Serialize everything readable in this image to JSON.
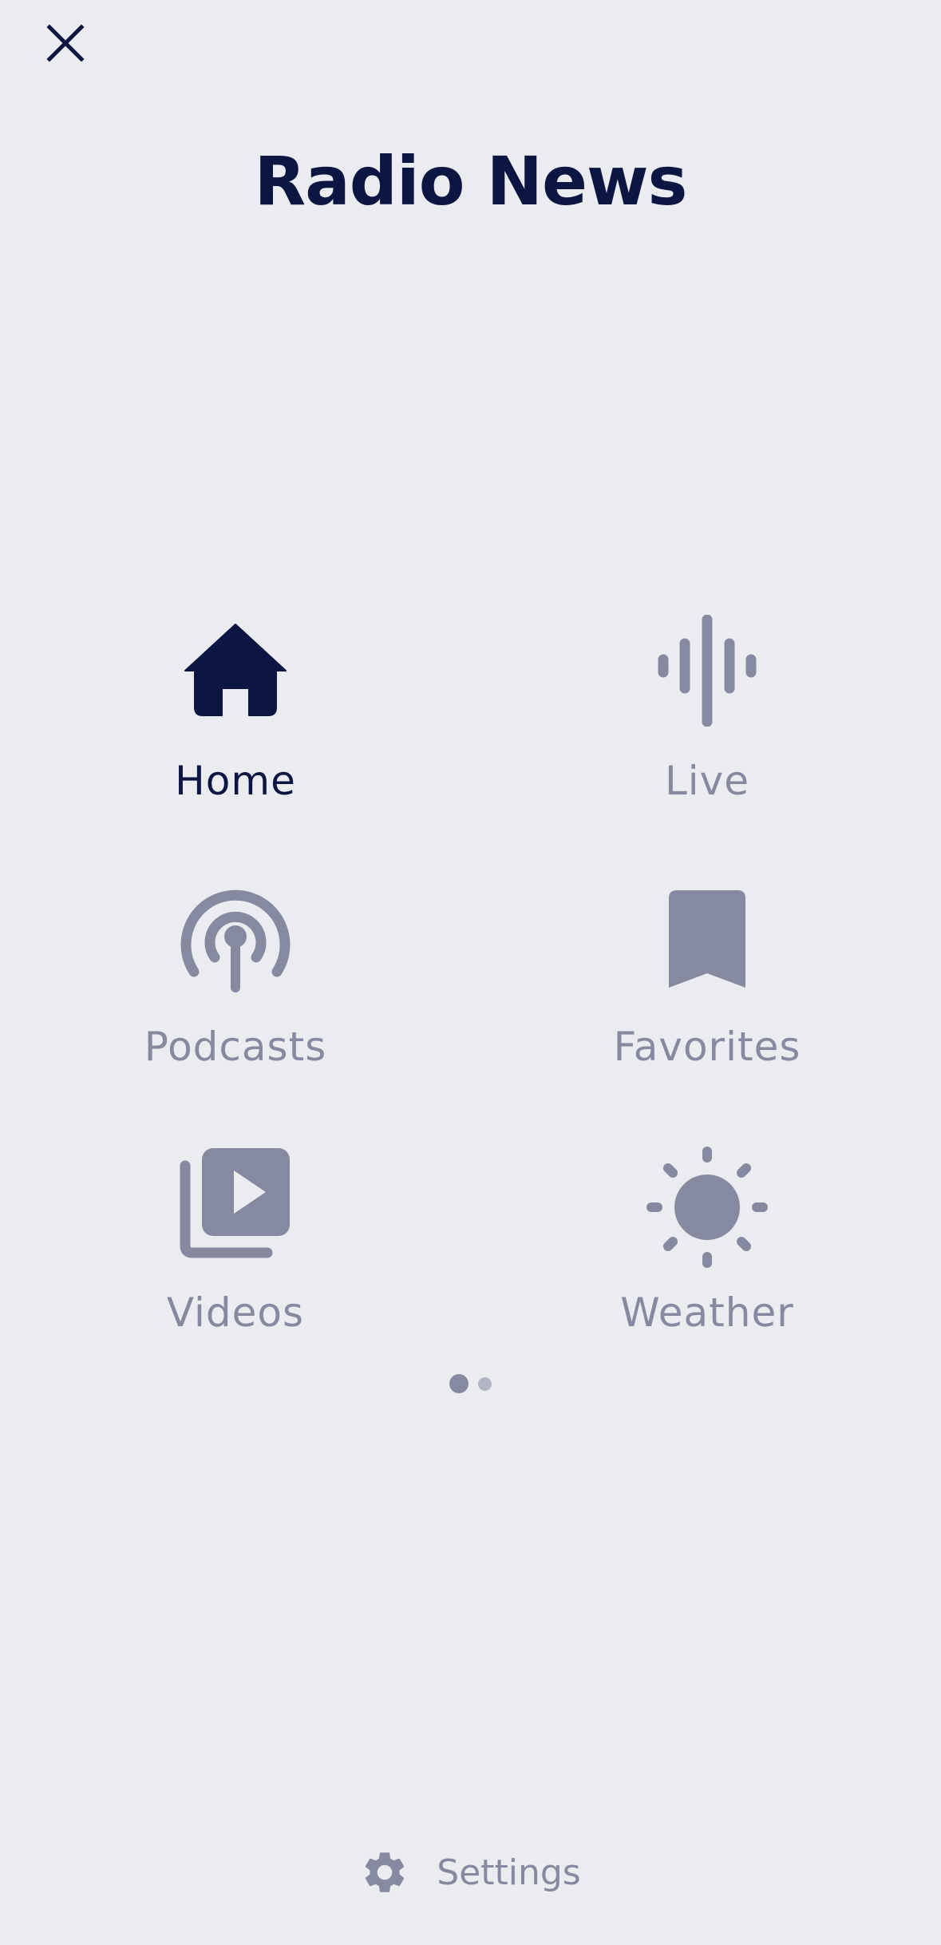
{
  "header": {
    "title": "Radio News",
    "close_icon": "close-icon"
  },
  "menu": {
    "items": [
      {
        "label": "Home",
        "icon": "home-icon",
        "active": true
      },
      {
        "label": "Live",
        "icon": "audio-waveform-icon",
        "active": false
      },
      {
        "label": "Podcasts",
        "icon": "podcast-icon",
        "active": false
      },
      {
        "label": "Favorites",
        "icon": "bookmark-icon",
        "active": false
      },
      {
        "label": "Videos",
        "icon": "video-library-icon",
        "active": false
      },
      {
        "label": "Weather",
        "icon": "sun-icon",
        "active": false
      }
    ]
  },
  "pagination": {
    "current_page": 1,
    "total_pages": 2
  },
  "footer": {
    "settings_label": "Settings",
    "settings_icon": "gear-icon"
  },
  "colors": {
    "background": "#ebecf0",
    "active": "#0c1642",
    "inactive": "#858aa0"
  }
}
